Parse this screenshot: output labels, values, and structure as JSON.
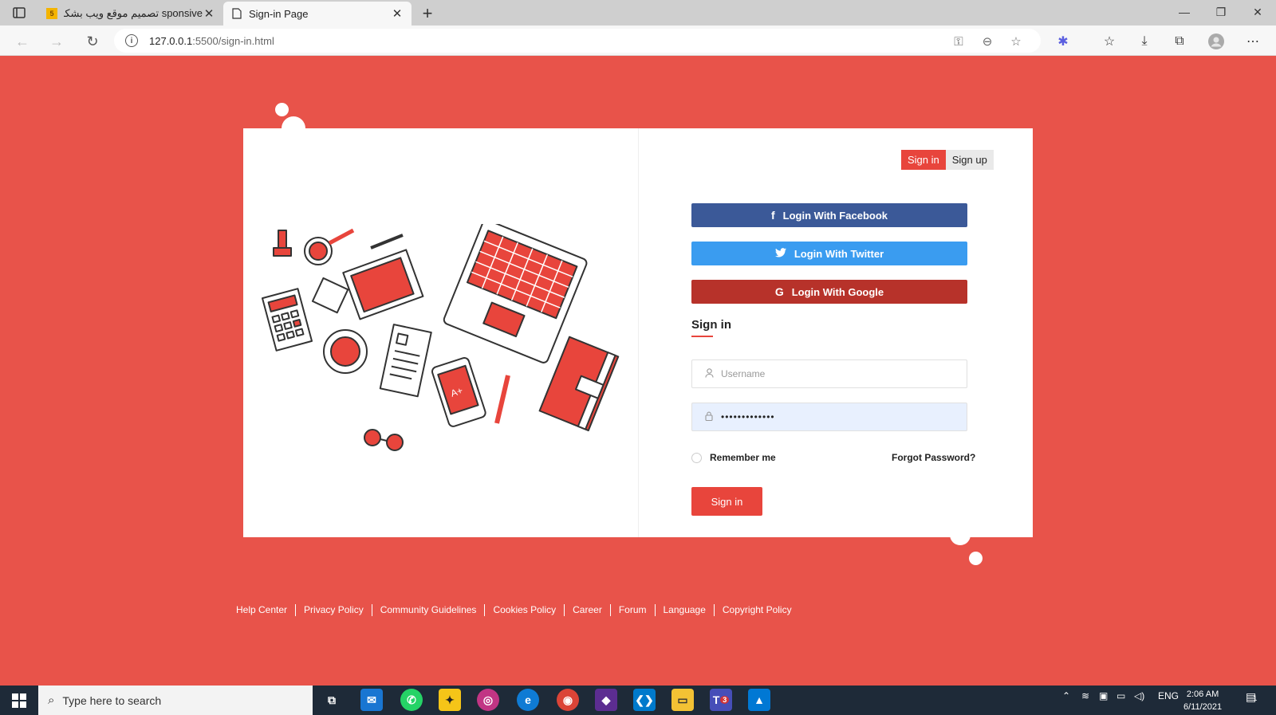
{
  "browser": {
    "tabs": [
      {
        "title": "تصميم موقع ويب بشكل Responsive",
        "display": "sponsive تصميم موقع ويب بشكل",
        "favicon": "5"
      },
      {
        "title": "Sign-in Page"
      }
    ],
    "url_host": "127.0.0.1",
    "url_path": ":5500/sign-in.html"
  },
  "auth_switch": {
    "signin": "Sign in",
    "signup": "Sign up"
  },
  "social": {
    "facebook": "Login With Facebook",
    "twitter": "Login With Twitter",
    "google": "Login With Google"
  },
  "form": {
    "title": "Sign in",
    "username_placeholder": "Username",
    "password_value": "•••••••••••••",
    "remember": "Remember me",
    "forgot": "Forgot Password?",
    "submit": "Sign in"
  },
  "footer": [
    "Help Center",
    "Privacy Policy",
    "Community Guidelines",
    "Cookies Policy",
    "Career",
    "Forum",
    "Language",
    "Copyright Policy"
  ],
  "taskbar": {
    "search_placeholder": "Type here to search",
    "language": "ENG",
    "time": "2:06 AM",
    "date": "6/11/2021",
    "teams_badge": "3",
    "notification_badge": "1"
  },
  "colors": {
    "accent": "#e8453c",
    "background": "#e8534a",
    "facebook": "#3b5998",
    "twitter": "#3a9cf0",
    "google": "#b7322a"
  }
}
